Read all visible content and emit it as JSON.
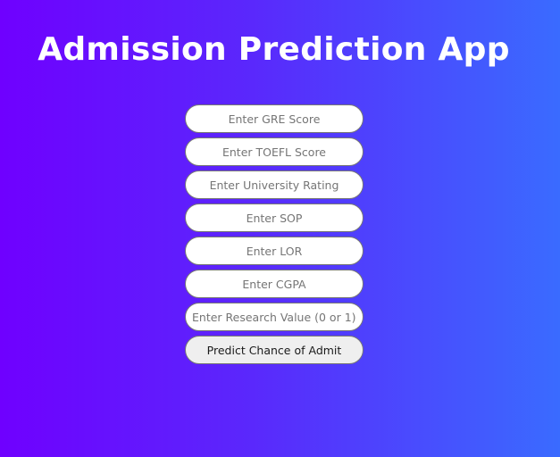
{
  "page": {
    "title": "Admission Prediction App"
  },
  "form": {
    "fields": [
      {
        "placeholder": "Enter GRE Score",
        "value": ""
      },
      {
        "placeholder": "Enter TOEFL Score",
        "value": ""
      },
      {
        "placeholder": "Enter University Rating",
        "value": ""
      },
      {
        "placeholder": "Enter SOP",
        "value": ""
      },
      {
        "placeholder": "Enter LOR",
        "value": ""
      },
      {
        "placeholder": "Enter CGPA",
        "value": ""
      },
      {
        "placeholder": "Enter Research Value (0 or 1)",
        "value": ""
      }
    ],
    "submit_label": "Predict Chance of Admit"
  },
  "colors": {
    "gradient_start": "#6f00ff",
    "gradient_end": "#3a6bff",
    "title_text": "#ffffff",
    "field_background": "#ffffff",
    "button_background": "#efefef"
  }
}
